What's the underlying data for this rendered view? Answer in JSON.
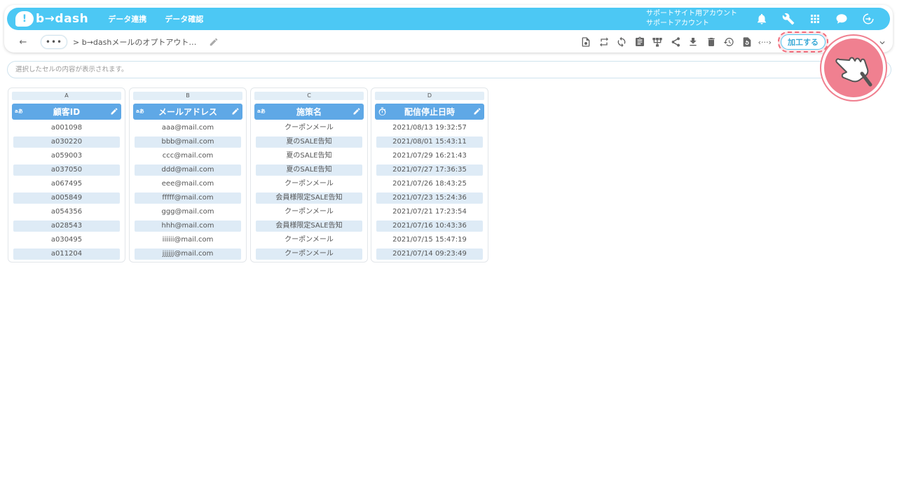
{
  "app": {
    "logo_mark": "!",
    "logo_text": "b→dash",
    "nav_links": [
      "データ連携",
      "データ確認"
    ],
    "account_line1": "サポートサイト用アカウント",
    "account_line2": "サポートアカウント"
  },
  "toolbar": {
    "back_label": "←",
    "more_label": "•••",
    "breadcrumb": "> b→dashメールのオプトアウト…",
    "code_label": "‹···›",
    "process_label": "加工する",
    "highlight_color": "#f26b7a",
    "accent_color": "#4cc8f4"
  },
  "cellbar": {
    "placeholder": "選択したセルの内容が表示されます。"
  },
  "columns": [
    {
      "letter": "A",
      "header": "顧客ID",
      "type_tag": "aあ",
      "cells": [
        "a001098",
        "a030220",
        "a059003",
        "a037050",
        "a067495",
        "a005849",
        "a054356",
        "a028543",
        "a030495",
        "a011204"
      ]
    },
    {
      "letter": "B",
      "header": "メールアドレス",
      "type_tag": "aあ",
      "cells": [
        "aaa@mail.com",
        "bbb@mail.com",
        "ccc@mail.com",
        "ddd@mail.com",
        "eee@mail.com",
        "fffff@mail.com",
        "ggg@mail.com",
        "hhh@mail.com",
        "iiiiii@mail.com",
        "jjjjjj@mail.com"
      ]
    },
    {
      "letter": "C",
      "header": "施策名",
      "type_tag": "aあ",
      "cells": [
        "クーポンメール",
        "夏のSALE告知",
        "夏のSALE告知",
        "夏のSALE告知",
        "クーポンメール",
        "会員様限定SALE告知",
        "クーポンメール",
        "会員様限定SALE告知",
        "クーポンメール",
        "クーポンメール"
      ]
    },
    {
      "letter": "D",
      "header": "配信停止日時",
      "type_tag": "clock",
      "cells": [
        "2021/08/13 19:32:57",
        "2021/08/01 15:43:11",
        "2021/07/29 16:21:43",
        "2021/07/27 17:36:35",
        "2021/07/26 18:43:25",
        "2021/07/23 15:24:36",
        "2021/07/21 17:23:54",
        "2021/07/16 10:43:36",
        "2021/07/15 15:47:19",
        "2021/07/14 09:23:49"
      ]
    }
  ]
}
